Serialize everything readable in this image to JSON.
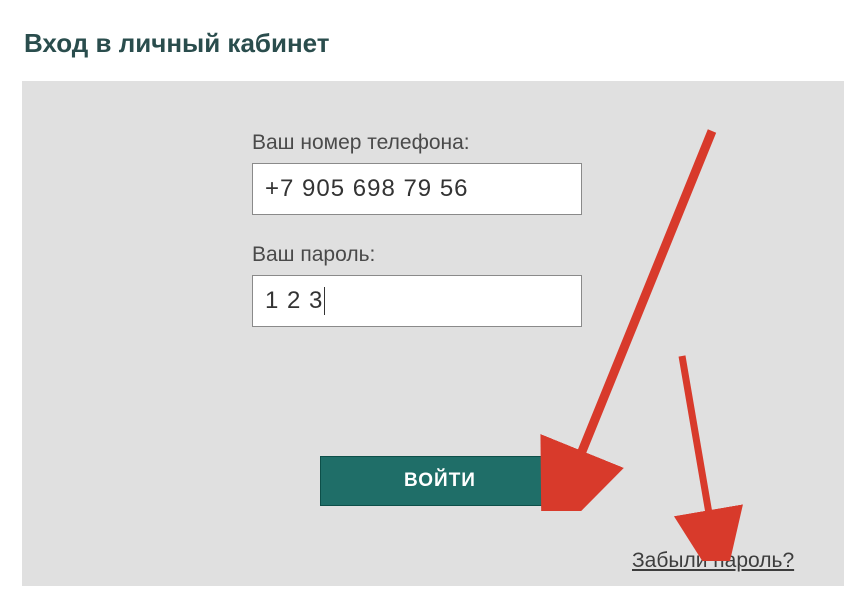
{
  "title": "Вход в личный кабинет",
  "form": {
    "phone_label": "Ваш номер телефона:",
    "phone_value": "+7 905 698 79 56",
    "password_label": "Ваш пароль:",
    "password_value": "1 2 3"
  },
  "buttons": {
    "login": "ВОЙТИ"
  },
  "links": {
    "forgot": "Забыли пароль?"
  },
  "annotation_color": "#d83a2b"
}
